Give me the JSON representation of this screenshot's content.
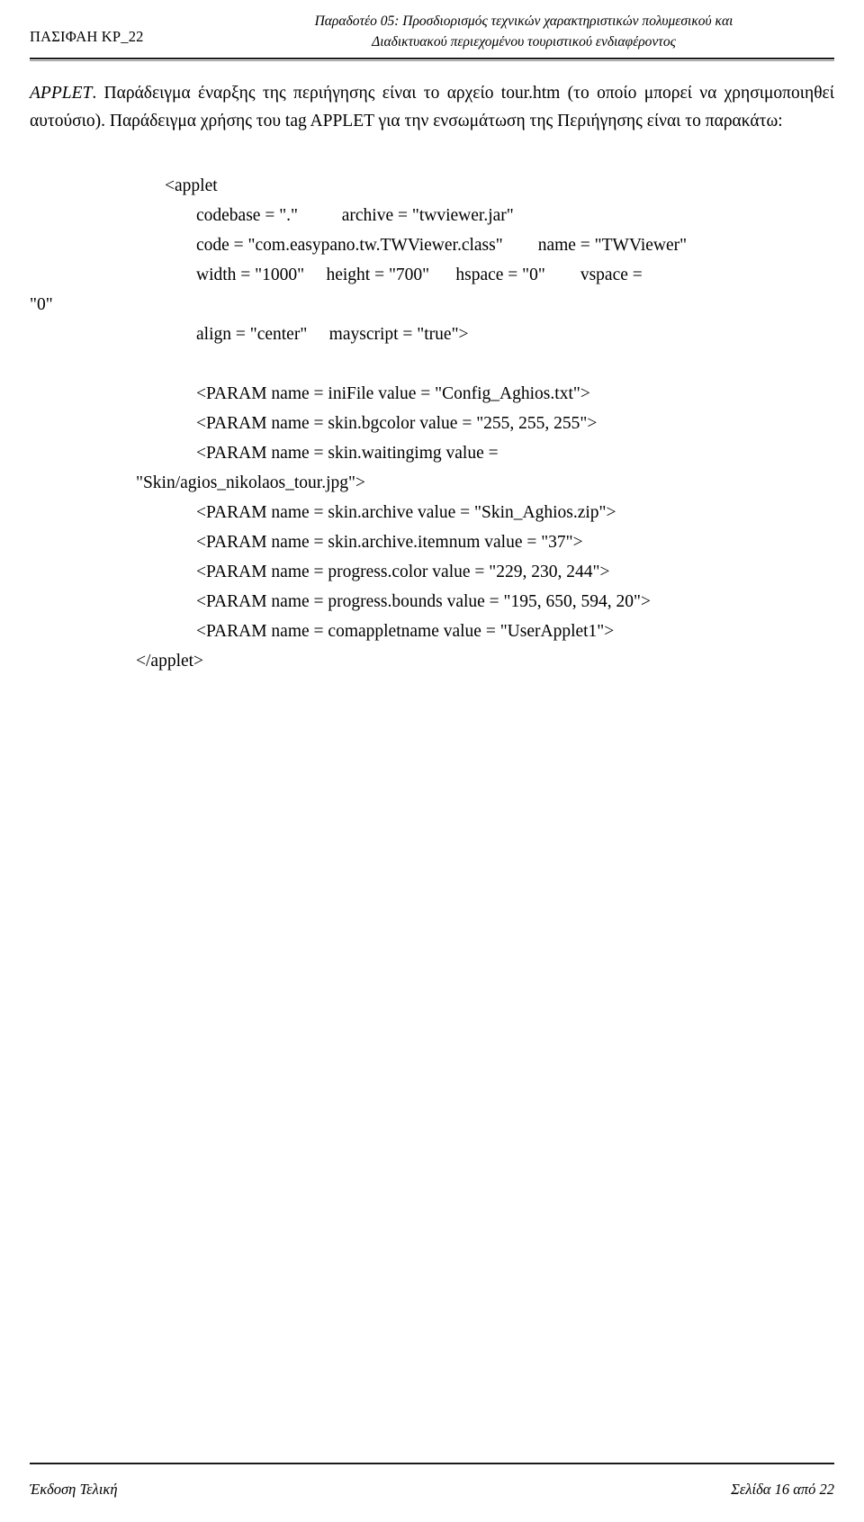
{
  "header": {
    "left_label": "ΠΑΣΙΦΑΗ ΚΡ_22",
    "title_line1": "Παραδοτέο 05: Προσδιορισμός τεχνικών χαρακτηριστικών πολυμεσικού και",
    "title_line2": "Διαδικτυακού περιεχομένου τουριστικού ενδιαφέροντος"
  },
  "body": {
    "paragraph_lead_italic": "APPLET",
    "paragraph": ". Παράδειγμα έναρξης της περιήγησης είναι το αρχείο tour.htm (το οποίο μπορεί να χρησιμοποιηθεί αυτούσιο). Παράδειγμα χρήσης του tag APPLET για την ενσωμάτωση της Περιήγησης είναι το παρακάτω:"
  },
  "code": {
    "line_applet_open": "<applet",
    "line_codebase": "codebase = \".\"          archive = \"twviewer.jar\"",
    "line_code_name": "code = \"com.easypano.tw.TWViewer.class\"        name = \"TWViewer\"",
    "line_dims": "width = \"1000\"     height = \"700\"      hspace = \"0\"        vspace =",
    "line_dims_cont": "\"0\"",
    "line_align": "align = \"center\"     mayscript = \"true\">",
    "param_inifile": "<PARAM name = iniFile value = \"Config_Aghios.txt\">",
    "param_bgcolor": "<PARAM name = skin.bgcolor value = \"255, 255, 255\">",
    "param_waitingimg": "<PARAM name = skin.waitingimg value =",
    "param_waitingimg_cont": "\"Skin/agios_nikolaos_tour.jpg\">",
    "param_skin_archive": "<PARAM name = skin.archive value = \"Skin_Aghios.zip\">",
    "param_skin_itemnum": "<PARAM name = skin.archive.itemnum value = \"37\">",
    "param_progress_color": "<PARAM name = progress.color value = \"229, 230, 244\">",
    "param_progress_bounds": "<PARAM name = progress.bounds value = \"195, 650, 594, 20\">",
    "param_comappletname": "<PARAM name = comappletname value = \"UserApplet1\">",
    "line_applet_close": "</applet>"
  },
  "footer": {
    "left": "Έκδοση Τελική",
    "right": "Σελίδα 16 από 22"
  }
}
